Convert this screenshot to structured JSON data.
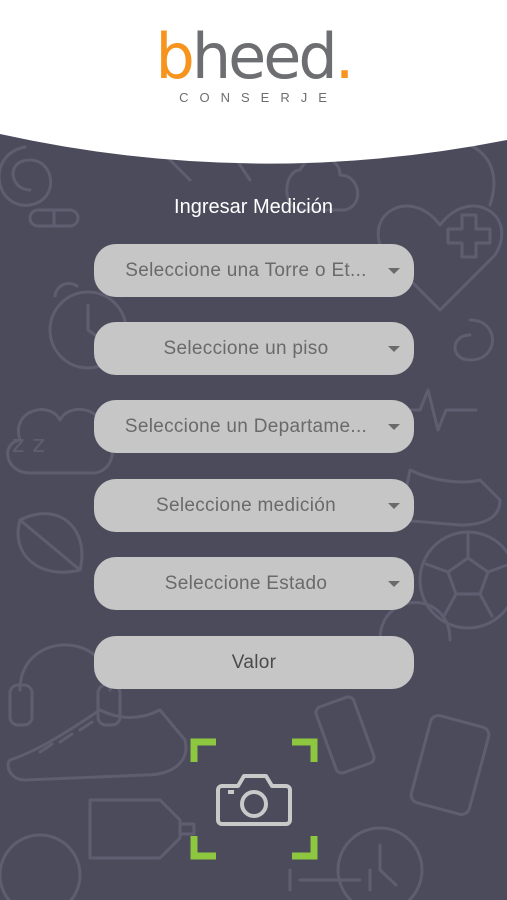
{
  "brand": {
    "logo_prefix": "b",
    "logo_main": "heed",
    "logo_dot": ".",
    "subtitle": "CONSERJE",
    "accent_color": "#f7941d",
    "text_color": "#6d6e71"
  },
  "form": {
    "title": "Ingresar Medición",
    "tower_select": "Seleccione una Torre o Et...",
    "floor_select": "Seleccione un piso",
    "apartment_select": "Seleccione un Departame...",
    "measurement_select": "Seleccione medición",
    "status_select": "Seleccione Estado",
    "value_placeholder": "Valor"
  },
  "camera": {
    "icon": "camera-icon",
    "frame_color": "#8dc63f"
  },
  "theme": {
    "background": "#4c4b5c",
    "field_background": "#c6c6c6"
  }
}
